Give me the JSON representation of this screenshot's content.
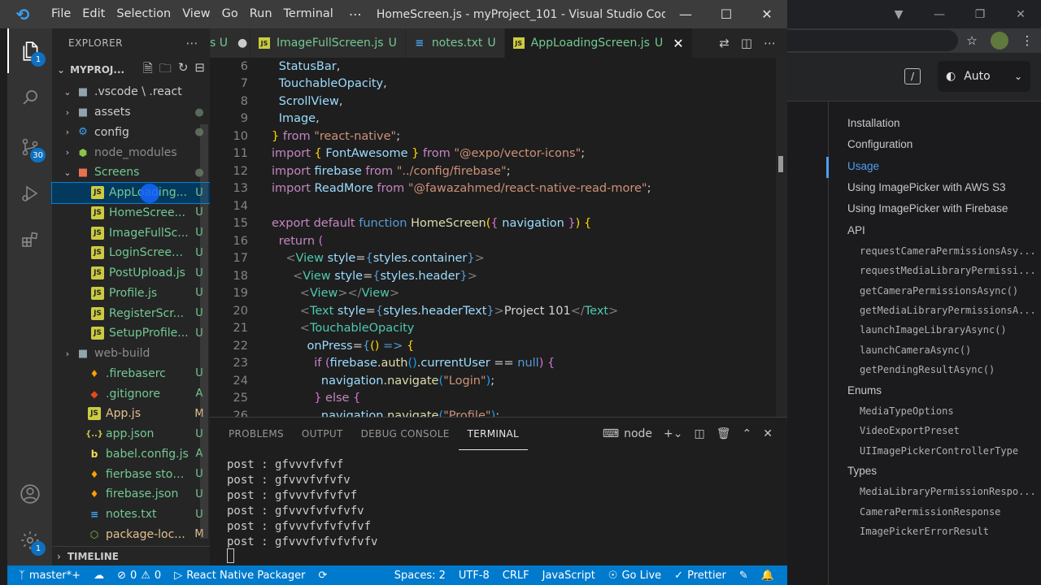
{
  "titlebar": {
    "menu": [
      "File",
      "Edit",
      "Selection",
      "View",
      "Go",
      "Run",
      "Terminal"
    ],
    "more": "⋯",
    "title": "HomeScreen.js - myProject_101 - Visual Studio Code [Admi...",
    "minimize": "—",
    "maximize": "☐",
    "close": "✕"
  },
  "activitybar": {
    "explorer_badge": "1",
    "scm_badge": "30",
    "settings_badge": "1"
  },
  "explorer": {
    "title": "EXPLORER",
    "project": "MYPROJ...",
    "timeline": "TIMELINE",
    "rows": [
      {
        "name": ".vscode \\ .react",
        "icon": "folder",
        "chev": "⌄",
        "indent": 1,
        "status": "",
        "cls": ""
      },
      {
        "name": "assets",
        "icon": "folder",
        "chev": "›",
        "indent": 1,
        "status": "●",
        "cls": ""
      },
      {
        "name": "config",
        "icon": "gear",
        "chev": "›",
        "indent": 1,
        "status": "●",
        "cls": ""
      },
      {
        "name": "node_modules",
        "icon": "node",
        "chev": "›",
        "indent": 1,
        "status": "",
        "cls": "dim"
      },
      {
        "name": "Screens",
        "icon": "folder-open",
        "chev": "⌄",
        "indent": 1,
        "status": "●",
        "cls": "folder-green"
      },
      {
        "name": "AppLoading...",
        "icon": "js",
        "chev": "",
        "indent": 2,
        "status": "U",
        "cls": "untracked",
        "selected": true
      },
      {
        "name": "HomeScree...",
        "icon": "js",
        "chev": "",
        "indent": 2,
        "status": "U",
        "cls": "untracked"
      },
      {
        "name": "ImageFullSc...",
        "icon": "js",
        "chev": "",
        "indent": 2,
        "status": "U",
        "cls": "untracked"
      },
      {
        "name": "LoginScreen...",
        "icon": "js",
        "chev": "",
        "indent": 2,
        "status": "U",
        "cls": "untracked"
      },
      {
        "name": "PostUpload.js",
        "icon": "js",
        "chev": "",
        "indent": 2,
        "status": "U",
        "cls": "untracked"
      },
      {
        "name": "Profile.js",
        "icon": "js",
        "chev": "",
        "indent": 2,
        "status": "U",
        "cls": "untracked"
      },
      {
        "name": "RegisterScr...",
        "icon": "js",
        "chev": "",
        "indent": 2,
        "status": "U",
        "cls": "untracked"
      },
      {
        "name": "SetupProfile...",
        "icon": "js",
        "chev": "",
        "indent": 2,
        "status": "U",
        "cls": "untracked"
      },
      {
        "name": "web-build",
        "icon": "folder",
        "chev": "›",
        "indent": 1,
        "status": "",
        "cls": "dim"
      },
      {
        "name": ".firebaserc",
        "icon": "fire",
        "chev": "",
        "indent": 1,
        "status": "U",
        "cls": "untracked"
      },
      {
        "name": ".gitignore",
        "icon": "git",
        "chev": "",
        "indent": 1,
        "status": "A",
        "cls": "untracked"
      },
      {
        "name": "App.js",
        "icon": "js",
        "chev": "",
        "indent": 1,
        "status": "M",
        "cls": "modified"
      },
      {
        "name": "app.json",
        "icon": "json",
        "chev": "",
        "indent": 1,
        "status": "U",
        "cls": "untracked"
      },
      {
        "name": "babel.config.js",
        "icon": "babel",
        "chev": "",
        "indent": 1,
        "status": "A",
        "cls": "untracked"
      },
      {
        "name": "fierbase stora...",
        "icon": "fire",
        "chev": "",
        "indent": 1,
        "status": "U",
        "cls": "untracked"
      },
      {
        "name": "firebase.json",
        "icon": "fire",
        "chev": "",
        "indent": 1,
        "status": "U",
        "cls": "untracked"
      },
      {
        "name": "notes.txt",
        "icon": "txt",
        "chev": "",
        "indent": 1,
        "status": "U",
        "cls": "untracked"
      },
      {
        "name": "package-loc...",
        "icon": "lock",
        "chev": "",
        "indent": 1,
        "status": "M",
        "cls": "modified"
      }
    ]
  },
  "tabs": [
    {
      "label": "s U",
      "icon": "",
      "status": "",
      "dirty": true,
      "active": false,
      "partial": true
    },
    {
      "label": "ImageFullScreen.js",
      "icon": "js",
      "status": "U",
      "active": false
    },
    {
      "label": "notes.txt",
      "icon": "txt",
      "status": "U",
      "active": false
    },
    {
      "label": "AppLoadingScreen.js",
      "icon": "js",
      "status": "U",
      "active": true
    }
  ],
  "code": [
    {
      "n": "6",
      "html": [
        [
          "v",
          "StatusBar"
        ],
        [
          "p",
          ","
        ]
      ],
      "indent": 1
    },
    {
      "n": "7",
      "html": [
        [
          "v",
          "TouchableOpacity"
        ],
        [
          "p",
          ","
        ]
      ],
      "indent": 1
    },
    {
      "n": "8",
      "html": [
        [
          "v",
          "ScrollView"
        ],
        [
          "p",
          ","
        ]
      ],
      "indent": 1
    },
    {
      "n": "9",
      "html": [
        [
          "v",
          "Image"
        ],
        [
          "p",
          ","
        ]
      ],
      "indent": 1
    },
    {
      "n": "10",
      "html": [
        [
          "b",
          "}"
        ],
        [
          "k",
          " from "
        ],
        [
          "s",
          "\"react-native\""
        ],
        [
          "p",
          ";"
        ]
      ],
      "indent": 0
    },
    {
      "n": "11",
      "html": [
        [
          "k",
          "import "
        ],
        [
          "b",
          "{ "
        ],
        [
          "v",
          "FontAwesome"
        ],
        [
          "b",
          " }"
        ],
        [
          "k",
          " from "
        ],
        [
          "s",
          "\"@expo/vector-icons\""
        ],
        [
          "p",
          ";"
        ]
      ],
      "indent": 0
    },
    {
      "n": "12",
      "html": [
        [
          "k",
          "import "
        ],
        [
          "v",
          "firebase"
        ],
        [
          "k",
          " from "
        ],
        [
          "s",
          "\"../config/firebase\""
        ],
        [
          "p",
          ";"
        ]
      ],
      "indent": 0
    },
    {
      "n": "13",
      "html": [
        [
          "k",
          "import "
        ],
        [
          "v",
          "ReadMore"
        ],
        [
          "k",
          " from "
        ],
        [
          "s",
          "\"@fawazahmed/react-native-read-more\""
        ],
        [
          "p",
          ";"
        ]
      ],
      "indent": 0
    },
    {
      "n": "14",
      "html": [],
      "indent": 0
    },
    {
      "n": "15",
      "html": [
        [
          "k",
          "export default "
        ],
        [
          "t",
          "function "
        ],
        [
          "f",
          "HomeScreen"
        ],
        [
          "b",
          "("
        ],
        [
          "pk",
          "{ "
        ],
        [
          "v",
          "navigation"
        ],
        [
          "pk",
          " }"
        ],
        [
          "b",
          ")"
        ],
        [
          "p",
          " "
        ],
        [
          "b",
          "{"
        ]
      ],
      "indent": 0
    },
    {
      "n": "16",
      "html": [
        [
          "k",
          "return "
        ],
        [
          "pk",
          "("
        ]
      ],
      "indent": 1
    },
    {
      "n": "17",
      "html": [
        [
          "g",
          "<"
        ],
        [
          "c",
          "View "
        ],
        [
          "v",
          "style"
        ],
        [
          "p",
          "="
        ],
        [
          "t",
          "{"
        ],
        [
          "v",
          "styles"
        ],
        [
          "p",
          "."
        ],
        [
          "v",
          "container"
        ],
        [
          "t",
          "}"
        ],
        [
          "g",
          ">"
        ]
      ],
      "indent": 2
    },
    {
      "n": "18",
      "html": [
        [
          "g",
          "<"
        ],
        [
          "c",
          "View "
        ],
        [
          "v",
          "style"
        ],
        [
          "p",
          "="
        ],
        [
          "t",
          "{"
        ],
        [
          "v",
          "styles"
        ],
        [
          "p",
          "."
        ],
        [
          "v",
          "header"
        ],
        [
          "t",
          "}"
        ],
        [
          "g",
          ">"
        ]
      ],
      "indent": 3
    },
    {
      "n": "19",
      "html": [
        [
          "g",
          "<"
        ],
        [
          "c",
          "View"
        ],
        [
          "g",
          "></"
        ],
        [
          "c",
          "View"
        ],
        [
          "g",
          ">"
        ]
      ],
      "indent": 4
    },
    {
      "n": "20",
      "html": [
        [
          "g",
          "<"
        ],
        [
          "c",
          "Text "
        ],
        [
          "v",
          "style"
        ],
        [
          "p",
          "="
        ],
        [
          "t",
          "{"
        ],
        [
          "v",
          "styles"
        ],
        [
          "p",
          "."
        ],
        [
          "v",
          "headerText"
        ],
        [
          "t",
          "}"
        ],
        [
          "g",
          ">"
        ],
        [
          "p",
          "Project 101"
        ],
        [
          "g",
          "</"
        ],
        [
          "c",
          "Text"
        ],
        [
          "g",
          ">"
        ]
      ],
      "indent": 4
    },
    {
      "n": "21",
      "html": [
        [
          "g",
          "<"
        ],
        [
          "c",
          "TouchableOpacity"
        ]
      ],
      "indent": 4
    },
    {
      "n": "22",
      "html": [
        [
          "v",
          "onPress"
        ],
        [
          "p",
          "="
        ],
        [
          "t",
          "{"
        ],
        [
          "b",
          "() "
        ],
        [
          "t",
          "=> "
        ],
        [
          "b",
          "{"
        ]
      ],
      "indent": 5
    },
    {
      "n": "23",
      "html": [
        [
          "k",
          "if "
        ],
        [
          "pk",
          "("
        ],
        [
          "v",
          "firebase"
        ],
        [
          "p",
          "."
        ],
        [
          "f",
          "auth"
        ],
        [
          "bl",
          "()"
        ],
        [
          "p",
          "."
        ],
        [
          "v",
          "currentUser"
        ],
        [
          "p",
          " == "
        ],
        [
          "t",
          "null"
        ],
        [
          "pk",
          ")"
        ],
        [
          "p",
          " "
        ],
        [
          "pk",
          "{"
        ]
      ],
      "indent": 6
    },
    {
      "n": "24",
      "html": [
        [
          "v",
          "navigation"
        ],
        [
          "p",
          "."
        ],
        [
          "f",
          "navigate"
        ],
        [
          "bl",
          "("
        ],
        [
          "s",
          "\"Login\""
        ],
        [
          "bl",
          ")"
        ],
        [
          "p",
          ";"
        ]
      ],
      "indent": 7
    },
    {
      "n": "25",
      "html": [
        [
          "pk",
          "} "
        ],
        [
          "k",
          "else "
        ],
        [
          "pk",
          "{"
        ]
      ],
      "indent": 6
    },
    {
      "n": "26",
      "html": [
        [
          "v",
          "navigation"
        ],
        [
          "p",
          "."
        ],
        [
          "f",
          "navigate"
        ],
        [
          "bl",
          "("
        ],
        [
          "s",
          "\"Profile\""
        ],
        [
          "bl",
          ")"
        ],
        [
          "p",
          ";"
        ]
      ],
      "indent": 7
    }
  ],
  "panel": {
    "tabs": [
      "PROBLEMS",
      "OUTPUT",
      "DEBUG CONSOLE",
      "TERMINAL"
    ],
    "active_tab": "TERMINAL",
    "terminal_name": "node",
    "lines": [
      "post : gfvvvfvfvf",
      "post : gfvvvfvfvfv",
      "post : gfvvvfvfvfvf",
      "post : gfvvvfvfvfvfv",
      "post : gfvvvfvfvfvfvf",
      "post : gfvvvfvfvfvfvfv"
    ]
  },
  "statusbar": {
    "branch": "master*+",
    "errors": "0",
    "warnings": "0",
    "packager": "React Native Packager",
    "spaces": "Spaces: 2",
    "encoding": "UTF-8",
    "eol": "CRLF",
    "language": "JavaScript",
    "golive": "Go Live",
    "prettier": "Prettier"
  },
  "browser": {
    "theme_label": "Auto",
    "slash": "/",
    "toc": [
      {
        "label": "Installation",
        "kind": "h",
        "active": false
      },
      {
        "label": "Configuration",
        "kind": "h",
        "active": false
      },
      {
        "label": "Usage",
        "kind": "h",
        "active": true
      },
      {
        "label": "Using ImagePicker with AWS S3",
        "kind": "h",
        "active": false
      },
      {
        "label": "Using ImagePicker with Firebase",
        "kind": "h",
        "active": false
      },
      {
        "label": "API",
        "kind": "h",
        "active": false
      },
      {
        "label": "requestCameraPermissionsAsy...",
        "kind": "code",
        "active": false
      },
      {
        "label": "requestMediaLibraryPermissi...",
        "kind": "code",
        "active": false
      },
      {
        "label": "getCameraPermissionsAsync()",
        "kind": "code",
        "active": false
      },
      {
        "label": "getMediaLibraryPermissionsA...",
        "kind": "code",
        "active": false
      },
      {
        "label": "launchImageLibraryAsync()",
        "kind": "code",
        "active": false
      },
      {
        "label": "launchCameraAsync()",
        "kind": "code",
        "active": false
      },
      {
        "label": "getPendingResultAsync()",
        "kind": "code",
        "active": false
      },
      {
        "label": "Enums",
        "kind": "h",
        "active": false
      },
      {
        "label": "MediaTypeOptions",
        "kind": "code",
        "active": false
      },
      {
        "label": "VideoExportPreset",
        "kind": "code",
        "active": false
      },
      {
        "label": "UIImagePickerControllerType",
        "kind": "code",
        "active": false
      },
      {
        "label": "Types",
        "kind": "h",
        "active": false
      },
      {
        "label": "MediaLibraryPermissionRespo...",
        "kind": "code",
        "active": false
      },
      {
        "label": "CameraPermissionResponse",
        "kind": "code",
        "active": false
      },
      {
        "label": "ImagePickerErrorResult",
        "kind": "code",
        "active": false
      }
    ]
  }
}
